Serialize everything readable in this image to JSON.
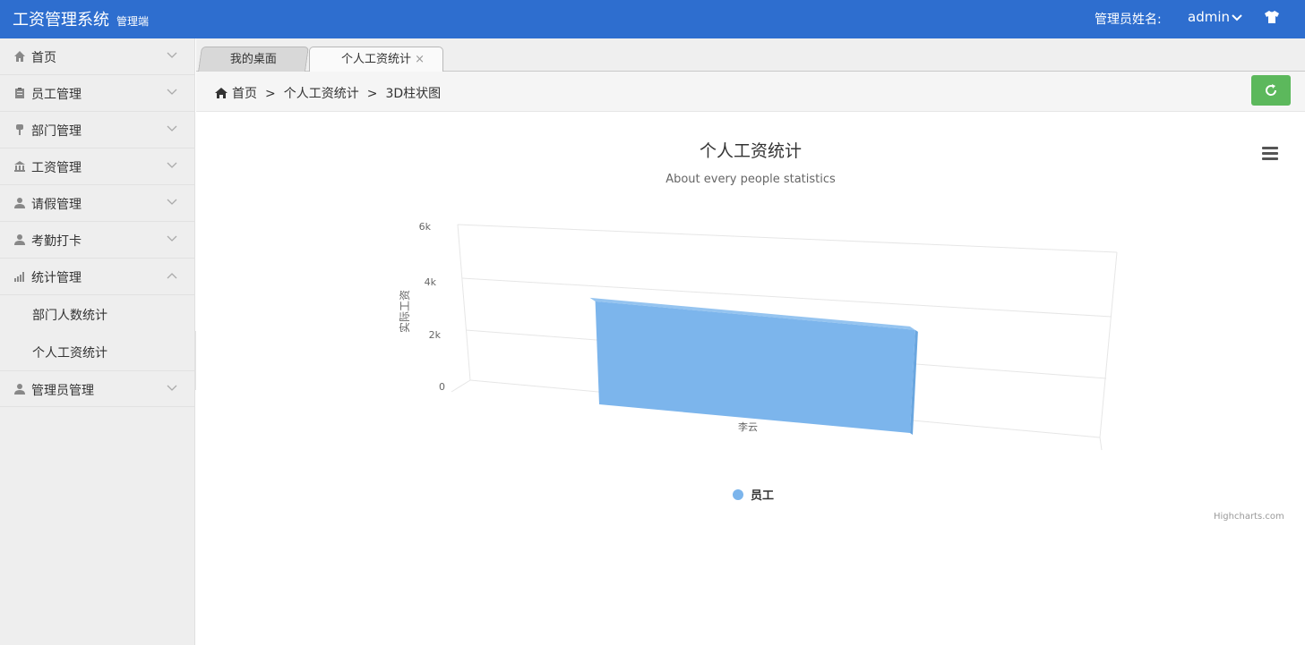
{
  "header": {
    "app_title": "工资管理系统",
    "app_subtitle": "管理端",
    "admin_label": "管理员姓名:",
    "admin_name": "admin"
  },
  "sidebar": {
    "items": [
      {
        "label": "首页",
        "icon": "home-icon"
      },
      {
        "label": "员工管理",
        "icon": "clipboard-icon"
      },
      {
        "label": "部门管理",
        "icon": "pushpin-icon"
      },
      {
        "label": "工资管理",
        "icon": "bank-icon"
      },
      {
        "label": "请假管理",
        "icon": "user-icon"
      },
      {
        "label": "考勤打卡",
        "icon": "user-icon"
      },
      {
        "label": "统计管理",
        "icon": "stats-icon",
        "expanded": true
      },
      {
        "label": "管理员管理",
        "icon": "user-icon"
      }
    ],
    "sub_items": [
      "部门人数统计",
      "个人工资统计"
    ]
  },
  "tabs": [
    {
      "label": "我的桌面"
    },
    {
      "label": "个人工资统计",
      "active": true,
      "close": "×"
    }
  ],
  "breadcrumb": [
    "首页",
    "个人工资统计",
    "3D柱状图"
  ],
  "breadcrumb_sep": ">",
  "chart": {
    "credits": "Highcharts.com",
    "colors": {
      "series": "#7cb5ec",
      "primary": "#2e6ecf",
      "success": "#5cb85c"
    }
  },
  "chart_data": {
    "type": "bar",
    "title": "个人工资统计",
    "subtitle": "About every people statistics",
    "categories": [
      "李云"
    ],
    "series": [
      {
        "name": "员工",
        "values": [
          4400
        ]
      }
    ],
    "ylabel": "实际工资",
    "xlabel": "",
    "ylim": [
      0,
      6000
    ],
    "yticks": [
      "0",
      "2k",
      "4k",
      "6k"
    ],
    "grid": true,
    "legend": "bottom-center",
    "three_d": true
  }
}
